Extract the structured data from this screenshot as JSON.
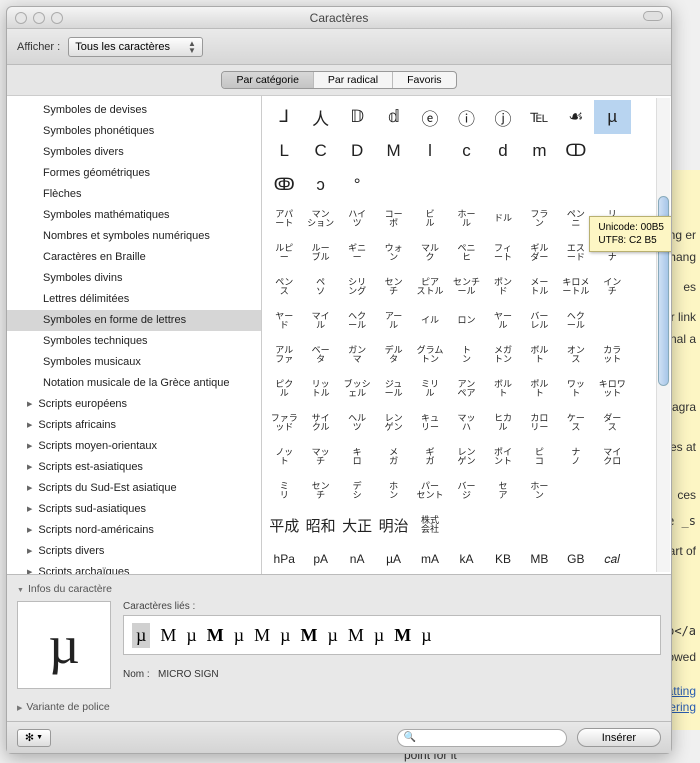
{
  "window": {
    "title": "Caractères"
  },
  "toolbar": {
    "show_label": "Afficher :",
    "select_value": "Tous les caractères"
  },
  "tabs": {
    "items": [
      "Par catégorie",
      "Par radical",
      "Favoris"
    ],
    "active": 0
  },
  "sidebar": {
    "items": [
      "Symboles de devises",
      "Symboles phonétiques",
      "Symboles divers",
      "Formes géométriques",
      "Flèches",
      "Symboles mathématiques",
      "Nombres et symboles numériques",
      "Caractères en Braille",
      "Symboles divins",
      "Lettres délimitées",
      "Symboles en forme de lettres",
      "Symboles techniques",
      "Symboles musicaux",
      "Notation musicale de la Grèce antique"
    ],
    "selected": 10,
    "groups": [
      "Scripts européens",
      "Scripts africains",
      "Scripts moyen-orientaux",
      "Scripts est-asiatiques",
      "Scripts du Sud-Est asiatique",
      "Scripts sud-asiatiques",
      "Scripts nord-américains",
      "Scripts divers",
      "Scripts archaïques"
    ]
  },
  "grid": {
    "row0": [
      "⅃",
      "人",
      "𝔻",
      "𝕕",
      "ⓔ",
      "ⓘ",
      "ⓙ",
      "℡",
      "☙",
      "µ",
      ""
    ],
    "row1": [
      "L",
      "C",
      "D",
      "M",
      "l",
      "c",
      "d",
      "m",
      "ↀ",
      "",
      ""
    ],
    "row2": [
      "ↂ",
      "ↄ",
      "°",
      "",
      "",
      "",
      "",
      "",
      "",
      "",
      ""
    ],
    "rowA": [
      "アパ\nート",
      "マン\nション",
      "ハイ\nツ",
      "コー\nポ",
      "ビ\nル",
      "ホー\nル",
      "ドル",
      "フラ\nン",
      "ペン\nニ",
      "リ\nラ"
    ],
    "rowB": [
      "ルピ\nー",
      "ルー\nブル",
      "ギニ\nー",
      "ウォ\nン",
      "マル\nク",
      "ペニ\nヒ",
      "フィ\nート",
      "ギル\nダー",
      "エス\nード",
      "コル\nナ"
    ],
    "rowC": [
      "ペン\nス",
      "ペ\nソ",
      "シリ\nング",
      "セン\nチ",
      "ピア\nストル",
      "センチ\nール",
      "ポン\nド",
      "メー\nトル",
      "キロメ\nートル",
      "イン\nチ"
    ],
    "rowD": [
      "ヤー\nド",
      "マイ\nル",
      "ヘク\nール",
      "アー\nル",
      "イル",
      "ロン",
      "ヤー\nル",
      "バー\nレル",
      "ヘク\nール",
      ""
    ],
    "rowE": [
      "アル\nファ",
      "ベー\nタ",
      "ガン\nマ",
      "デル\nタ",
      "グラム\nトン",
      "ト\nン",
      "メガ\nトン",
      "ボル\nト",
      "オン\nス",
      "カラ\nット"
    ],
    "rowF": [
      "ピク\nル",
      "リッ\nトル",
      "ブッシ\nェル",
      "ジュ\nール",
      "ミリ\nル",
      "アン\nペア",
      "ボル\nト",
      "ポル\nト",
      "ワッ\nト",
      "キロワ\nット"
    ],
    "rowG": [
      "ファラ\nッド",
      "サイ\nクル",
      "ヘル\nツ",
      "レン\nゲン",
      "キュ\nリー",
      "マッ\nハ",
      "ヒカ\nル",
      "カロ\nリー",
      "ケー\nス",
      "ダー\nス"
    ],
    "rowH": [
      "ノッ\nト",
      "マッ\nチ",
      "キ\nロ",
      "メ\nガ",
      "ギ\nガ",
      "レン\nゲン",
      "ポイ\nント",
      "ピ\nコ",
      "ナ\nノ",
      "マイ\nクロ"
    ],
    "rowI": [
      "ミ\nリ",
      "セン\nチ",
      "デ\nシ",
      "ホ\nン",
      "パー\nセント",
      "バー\nジ",
      "セ\nア",
      "ホー\nン",
      "",
      ""
    ],
    "rowJ": [
      "平成",
      "昭和",
      "大正",
      "明治",
      "株式\n会社",
      "",
      "",
      "",
      "",
      ""
    ],
    "rowK": [
      "hPa",
      "pA",
      "nA",
      "µA",
      "mA",
      "kA",
      "KB",
      "MB",
      "GB",
      "𝑐𝑎𝑙"
    ]
  },
  "tooltip": {
    "line1": "Unicode: 00B5",
    "line2": "UTF8: C2 B5"
  },
  "info": {
    "header": "Infos du caractère",
    "related_label": "Caractères liés :",
    "preview_glyph": "µ",
    "related": [
      "µ",
      "M",
      "µ",
      "M",
      "µ",
      "M",
      "µ",
      "M",
      "µ",
      "M",
      "µ",
      "M",
      "µ"
    ],
    "name_label": "Nom :",
    "name_value": "MICRO SIGN",
    "variant_header": "Variante de police"
  },
  "bottombar": {
    "insert": "Insérer",
    "search_placeholder": ""
  },
  "bg": {
    "t0": "elling er",
    "t1": "ut chang",
    "t2": "es",
    "t3": "s or link",
    "t4": "riginal a",
    "t5": "paragra",
    "t6": "paces at",
    "t7": "ces",
    "t8": "like _s",
    "t9": "start of",
    "t10": "'>foo</a",
    "t11": "owed",
    "t12": "rmatting",
    "t13": "swering",
    "t14": "point for it"
  }
}
